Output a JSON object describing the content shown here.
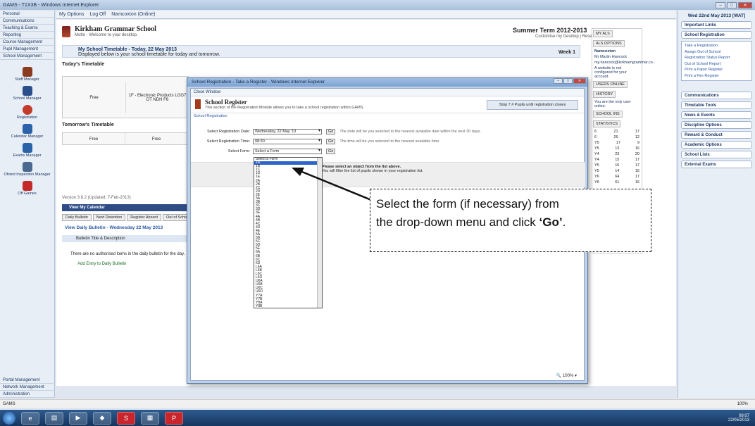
{
  "window": {
    "title": "GAMS - T1X3B - Windows Internet Explorer",
    "controls": [
      "–",
      "□",
      "✕"
    ]
  },
  "toolbar": {
    "options": "My Options",
    "logoff": "Log Off",
    "user": "Namcoxton (Online)"
  },
  "leftnav": {
    "top_items": [
      "Personal",
      "Communications",
      "Teaching & Exams",
      "Reporting",
      "Course Management",
      "Pupil Management",
      "School Management"
    ],
    "icon_items": [
      {
        "label": "Staff Manager",
        "icon": "person-icon",
        "color": "#8a3b20"
      },
      {
        "label": "School Manager",
        "icon": "building-icon",
        "color": "#2b4f8a"
      },
      {
        "label": "Registration",
        "icon": "clock-icon",
        "color": "#c33b2b"
      },
      {
        "label": "Calendar Manager",
        "icon": "calendar-icon",
        "color": "#2b63a8"
      },
      {
        "label": "Exams Manager",
        "icon": "exam-icon",
        "color": "#2b63a8"
      },
      {
        "label": "Ofsted Inspection Manager",
        "icon": "inspection-icon",
        "color": "#4a6a90"
      },
      {
        "label": "Off Games",
        "icon": "games-icon",
        "color": "#c32b2b"
      }
    ],
    "bottom_items": [
      "Portal Management",
      "Network Management",
      "Administration"
    ]
  },
  "main": {
    "school_name": "Kirkham Grammar School",
    "school_sub": "Motto - Welcome to your desktop.",
    "term": "Summer Term 2012-2013",
    "term_sub": "Customise my Desktop | Reset",
    "tt_bar_title": "My School Timetable - Today, 22 May 2013",
    "tt_bar_sub": "Displayed below is your school timetable for today and tomorrow.",
    "week": "Week 1",
    "today_title": "Today's Timetable",
    "free": "Free",
    "lesson": "1F - Electronic Products LGG7 DT NDH F6",
    "tomorrow_title": "Tomorrow's Timetable",
    "version": "Version 3.8.2 (Updated: 7-Feb-2013)",
    "calendar_bar": "View My Calendar",
    "tabs": [
      "Daily Bulletin",
      "Next Detention",
      "Register Absent",
      "Out of School"
    ],
    "bulletin_title": "View Daily Bulletin - Wednesday 22 May 2013",
    "bulletin_head": "Bulletin Title & Description",
    "bulletin_row": "There are no authorised items in the daily bulletin for the day.",
    "bulletin_add": "Add Entry to Daily Bulletin"
  },
  "midcol": {
    "tabs": [
      "MY ALS",
      "ALS OPTIONS"
    ],
    "lines": [
      "Namcoxton",
      "Mr Martin Hancock",
      "my.hancock@kirkhamgrammar.co..",
      "A website is not configured for your account."
    ],
    "users_tabs": [
      "USERS ONLINE",
      "HISTORY"
    ],
    "users_note": "You are the only user online.",
    "school_tabs": [
      "SCHOOL INS",
      "STATISTICS"
    ],
    "rows": [
      [
        "6",
        "21",
        "17"
      ],
      [
        "6",
        "26",
        "12"
      ],
      [
        "Y5",
        "17",
        "9"
      ],
      [
        "Y5",
        "13",
        "16"
      ],
      [
        "Y4",
        "23",
        "20"
      ],
      [
        "Y4",
        "15",
        "17"
      ],
      [
        "Y5",
        "16",
        "17"
      ],
      [
        "Y5",
        "14",
        "16"
      ],
      [
        "Y6",
        "64",
        "17"
      ],
      [
        "Y6",
        "61",
        "16"
      ]
    ]
  },
  "rightpanel": {
    "date": "Wed 22nd May 2013 [WAT]",
    "boxes_top": [
      "Important Links",
      "School Registration"
    ],
    "reg_links": [
      "Take a Registration",
      "Assign Out of School",
      "Registration Status Report",
      "Out of School Report",
      "Print a Paper Register",
      "Print a Fire Register"
    ],
    "boxes": [
      "Communications",
      "Timetable Tools",
      "News & Events",
      "Discipline Options",
      "Reward & Conduct",
      "Academic Options",
      "School Lists",
      "External Exams"
    ]
  },
  "dialog": {
    "title": "School Registration - Take a Register - Windows Internet Explorer",
    "close_window": "Close Window",
    "reg_title": "School Register",
    "reg_desc": "This section of the Registration Module allows you to take a school registration within GAMS.",
    "reg_note": "Stop 7 # Pupils until registration closes",
    "reg_sub": "School Registration",
    "date_label": "Select Registration Date:",
    "date_value": "Wednesday, 22 May '13",
    "date_hint": "The date will be you selected to the nearest available date within the next 30 days.",
    "time_label": "Select Registration Time:",
    "time_value": "08:30",
    "time_hint": "The time will be you selected to the nearest available time.",
    "form_label": "Select Form:",
    "form_value": "Select a Form",
    "go": "Go",
    "please_bold": "Please select an object from the list above.",
    "please_sub": "You will filter the list of pupils shown in your registration list.",
    "options": [
      "Select a Form",
      "1A",
      "1B",
      "1C",
      "1D",
      "1E",
      "2A",
      "2B",
      "2C",
      "2D",
      "2E",
      "3A",
      "3B",
      "3C",
      "3D",
      "3E",
      "4A",
      "4B",
      "4C",
      "4D",
      "4E",
      "5A",
      "5B",
      "5C",
      "5D",
      "5E",
      "6A",
      "6B",
      "6C",
      "6D",
      "L6A",
      "L6B",
      "L6C",
      "L6D",
      "U6A",
      "U6B",
      "U6C",
      "U6D",
      "Y7A",
      "Y7B",
      "Y8A",
      "Y8B"
    ],
    "zoom": "100%"
  },
  "callout": {
    "line1": "Select the form (if necessary) from",
    "line2_pre": "the drop-down menu and click ",
    "line2_go": "‘Go’",
    "line2_post": "."
  },
  "statusbar": {
    "left": "GAMS",
    "right": "100%"
  },
  "taskbar": {
    "time": "09:07",
    "date": "22/05/2013"
  }
}
